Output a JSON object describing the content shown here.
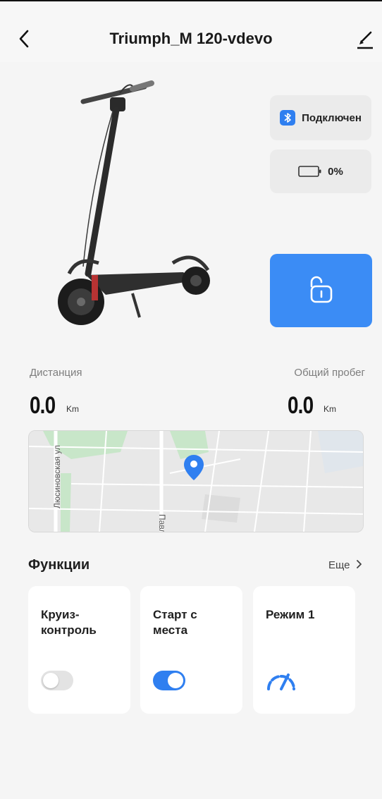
{
  "header": {
    "title": "Triumph_M 120-vdevo"
  },
  "status": {
    "connection": "Подключен",
    "battery_percent": "0%",
    "battery_level": 0
  },
  "stats": {
    "distance": {
      "label": "Дистанция",
      "value": "0.0",
      "unit": "Km"
    },
    "total": {
      "label": "Общий пробег",
      "value": "0.0",
      "unit": "Km"
    }
  },
  "map": {
    "streets": [
      "Люсиновская ул",
      "Павловская ул"
    ]
  },
  "functions": {
    "title": "Функции",
    "more": "Еще",
    "cards": [
      {
        "title": "Круиз-контроль",
        "control": "toggle",
        "state": "off"
      },
      {
        "title": "Старт с места",
        "control": "toggle",
        "state": "on"
      },
      {
        "title": "Режим 1",
        "control": "gauge-icon"
      }
    ]
  },
  "colors": {
    "accent": "#2f7ff0",
    "lock_button": "#3b8cf5",
    "card_bg": "#ffffff",
    "page_bg": "#f5f5f5"
  }
}
